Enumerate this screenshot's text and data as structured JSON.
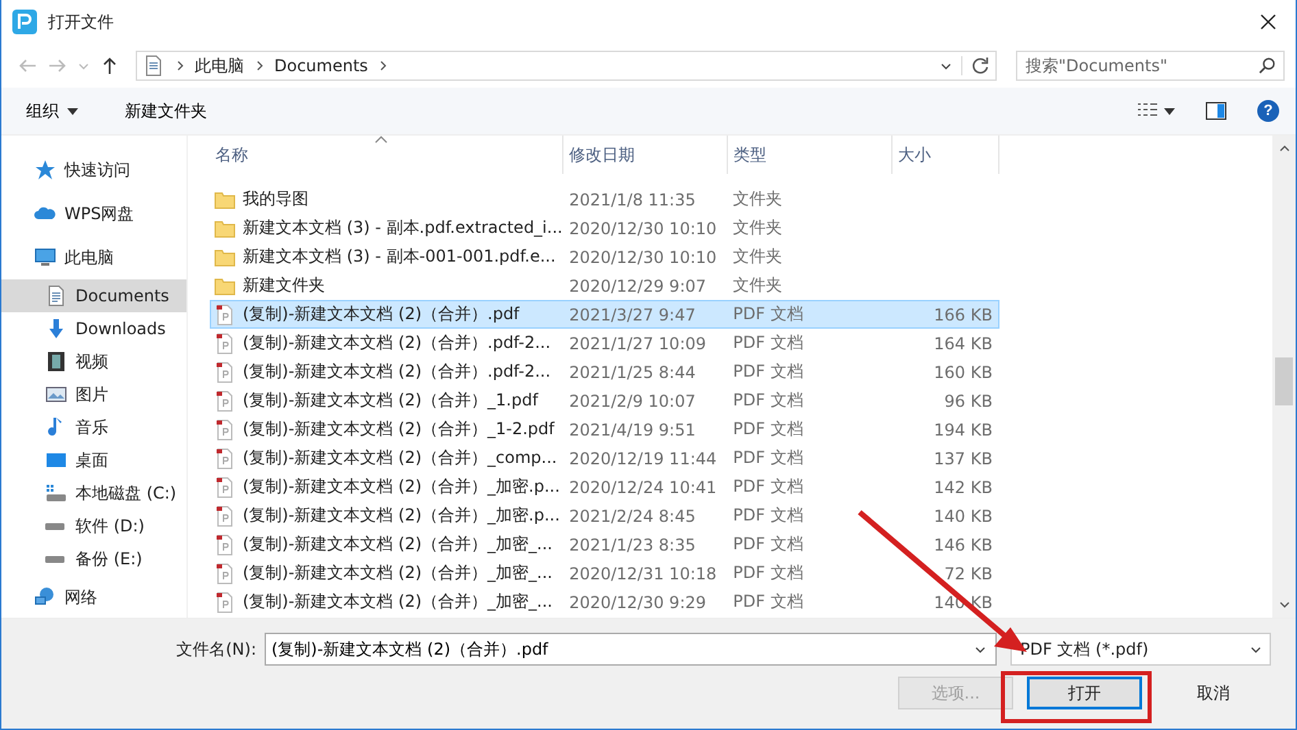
{
  "window": {
    "title": "打开文件"
  },
  "address": {
    "path": [
      "此电脑",
      "Documents"
    ]
  },
  "search": {
    "placeholder": "搜索\"Documents\""
  },
  "toolbar": {
    "organize": "组织",
    "new_folder": "新建文件夹",
    "help": "?"
  },
  "sidebar": {
    "items": [
      {
        "label": "快速访问",
        "kind": "star",
        "selected": false
      },
      {
        "label": "WPS网盘",
        "kind": "cloud",
        "selected": false
      },
      {
        "label": "此电脑",
        "kind": "pc",
        "selected": false,
        "children": [
          {
            "label": "Documents",
            "kind": "doc",
            "selected": true
          },
          {
            "label": "Downloads",
            "kind": "download",
            "selected": false
          },
          {
            "label": "视频",
            "kind": "video",
            "selected": false
          },
          {
            "label": "图片",
            "kind": "picture",
            "selected": false
          },
          {
            "label": "音乐",
            "kind": "music",
            "selected": false
          },
          {
            "label": "桌面",
            "kind": "desktop",
            "selected": false
          },
          {
            "label": "本地磁盘 (C:)",
            "kind": "sysdrive",
            "selected": false
          },
          {
            "label": "软件 (D:)",
            "kind": "drive",
            "selected": false
          },
          {
            "label": "备份 (E:)",
            "kind": "drive",
            "selected": false
          }
        ]
      },
      {
        "label": "网络",
        "kind": "network",
        "selected": false
      }
    ]
  },
  "table": {
    "columns": [
      "名称",
      "修改日期",
      "类型",
      "大小"
    ],
    "rows": [
      {
        "kind": "folder",
        "name": "我的导图",
        "date": "2021/1/8 11:35",
        "type": "文件夹",
        "selected": false
      },
      {
        "kind": "folder",
        "name": "新建文本文档 (3) - 副本.pdf.extracted_i...",
        "date": "2020/12/30 10:10",
        "type": "文件夹",
        "selected": false
      },
      {
        "kind": "folder",
        "name": "新建文本文档 (3) - 副本-001-001.pdf.e...",
        "date": "2020/12/30 10:10",
        "type": "文件夹",
        "selected": false
      },
      {
        "kind": "folder",
        "name": "新建文件夹",
        "date": "2020/12/29 9:07",
        "type": "文件夹",
        "selected": false
      },
      {
        "kind": "pdf",
        "name": "(复制)-新建文本文档 (2)（合并）.pdf",
        "date": "2021/3/27 9:47",
        "type": "PDF 文档",
        "size": "166 KB",
        "selected": true
      },
      {
        "kind": "pdf",
        "name": "(复制)-新建文本文档 (2)（合并）.pdf-2...",
        "date": "2021/1/27 10:09",
        "type": "PDF 文档",
        "size": "164 KB",
        "selected": false
      },
      {
        "kind": "pdf",
        "name": "(复制)-新建文本文档 (2)（合并）.pdf-2...",
        "date": "2021/1/25 8:44",
        "type": "PDF 文档",
        "size": "160 KB",
        "selected": false
      },
      {
        "kind": "pdf",
        "name": "(复制)-新建文本文档 (2)（合并）_1.pdf",
        "date": "2021/2/9 10:07",
        "type": "PDF 文档",
        "size": "96 KB",
        "selected": false
      },
      {
        "kind": "pdf",
        "name": "(复制)-新建文本文档 (2)（合并）_1-2.pdf",
        "date": "2021/4/19 9:51",
        "type": "PDF 文档",
        "size": "194 KB",
        "selected": false
      },
      {
        "kind": "pdf",
        "name": "(复制)-新建文本文档 (2)（合并）_comp...",
        "date": "2020/12/19 11:44",
        "type": "PDF 文档",
        "size": "137 KB",
        "selected": false
      },
      {
        "kind": "pdf",
        "name": "(复制)-新建文本文档 (2)（合并）_加密.p...",
        "date": "2020/12/24 10:41",
        "type": "PDF 文档",
        "size": "142 KB",
        "selected": false
      },
      {
        "kind": "pdf",
        "name": "(复制)-新建文本文档 (2)（合并）_加密.p...",
        "date": "2021/2/24 8:45",
        "type": "PDF 文档",
        "size": "140 KB",
        "selected": false
      },
      {
        "kind": "pdf",
        "name": "(复制)-新建文本文档 (2)（合并）_加密_...",
        "date": "2021/1/23 8:35",
        "type": "PDF 文档",
        "size": "146 KB",
        "selected": false
      },
      {
        "kind": "pdf",
        "name": "(复制)-新建文本文档 (2)（合并）_加密_...",
        "date": "2020/12/31 10:18",
        "type": "PDF 文档",
        "size": "72 KB",
        "selected": false
      },
      {
        "kind": "pdf",
        "name": "(复制)-新建文本文档 (2)（合并）_加密_...",
        "date": "2020/12/30 9:29",
        "type": "PDF 文档",
        "size": "140 KB",
        "selected": false
      }
    ]
  },
  "filename": {
    "label": "文件名(N):",
    "value": "(复制)-新建文本文档 (2)（合并）.pdf"
  },
  "filetype": {
    "value": "PDF 文档 (*.pdf)"
  },
  "buttons": [
    {
      "label": "选项...",
      "disabled": true,
      "kind": "options"
    },
    {
      "label": "打开",
      "disabled": false,
      "kind": "open"
    },
    {
      "label": "取消",
      "disabled": false,
      "kind": "cancel"
    }
  ]
}
